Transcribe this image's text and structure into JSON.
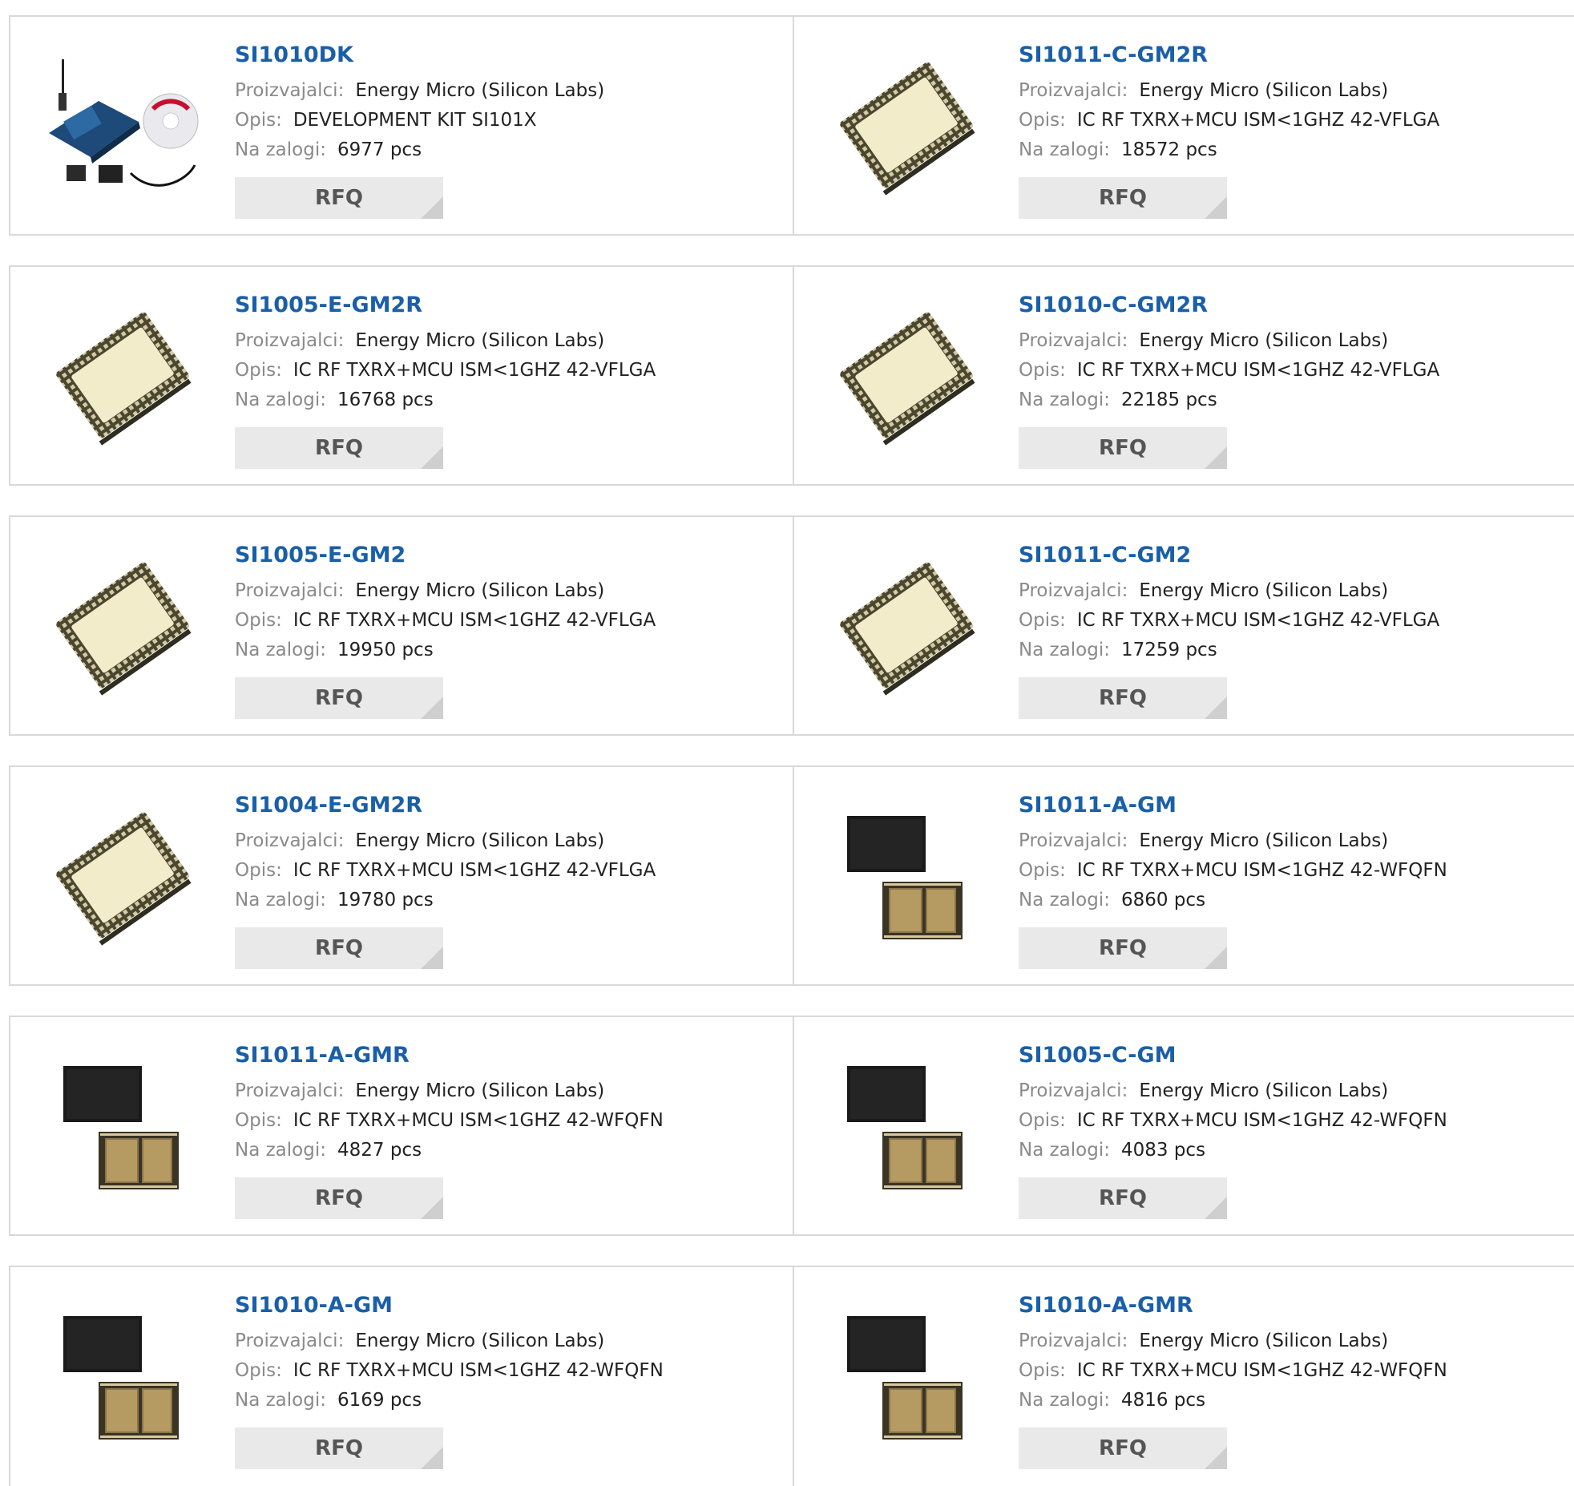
{
  "labels": {
    "manufacturer": "Proizvajalci:",
    "description": "Opis:",
    "stock": "Na zalogi:",
    "rfq": "RFQ"
  },
  "products": [
    {
      "name": "SI1010DK",
      "manufacturer": "Energy Micro (Silicon Labs)",
      "description": "DEVELOPMENT KIT SI101X",
      "stock": "6977 pcs",
      "image": "devkit"
    },
    {
      "name": "SI1011-C-GM2R",
      "manufacturer": "Energy Micro (Silicon Labs)",
      "description": "IC RF TXRX+MCU ISM<1GHZ 42-VFLGA",
      "stock": "18572 pcs",
      "image": "vflga"
    },
    {
      "name": "SI1005-E-GM2R",
      "manufacturer": "Energy Micro (Silicon Labs)",
      "description": "IC RF TXRX+MCU ISM<1GHZ 42-VFLGA",
      "stock": "16768 pcs",
      "image": "vflga"
    },
    {
      "name": "SI1010-C-GM2R",
      "manufacturer": "Energy Micro (Silicon Labs)",
      "description": "IC RF TXRX+MCU ISM<1GHZ 42-VFLGA",
      "stock": "22185 pcs",
      "image": "vflga"
    },
    {
      "name": "SI1005-E-GM2",
      "manufacturer": "Energy Micro (Silicon Labs)",
      "description": "IC RF TXRX+MCU ISM<1GHZ 42-VFLGA",
      "stock": "19950 pcs",
      "image": "vflga"
    },
    {
      "name": "SI1011-C-GM2",
      "manufacturer": "Energy Micro (Silicon Labs)",
      "description": "IC RF TXRX+MCU ISM<1GHZ 42-VFLGA",
      "stock": "17259 pcs",
      "image": "vflga"
    },
    {
      "name": "SI1004-E-GM2R",
      "manufacturer": "Energy Micro (Silicon Labs)",
      "description": "IC RF TXRX+MCU ISM<1GHZ 42-VFLGA",
      "stock": "19780 pcs",
      "image": "vflga"
    },
    {
      "name": "SI1011-A-GM",
      "manufacturer": "Energy Micro (Silicon Labs)",
      "description": "IC RF TXRX+MCU ISM<1GHZ 42-WFQFN",
      "stock": "6860 pcs",
      "image": "wfqfn"
    },
    {
      "name": "SI1011-A-GMR",
      "manufacturer": "Energy Micro (Silicon Labs)",
      "description": "IC RF TXRX+MCU ISM<1GHZ 42-WFQFN",
      "stock": "4827 pcs",
      "image": "wfqfn"
    },
    {
      "name": "SI1005-C-GM",
      "manufacturer": "Energy Micro (Silicon Labs)",
      "description": "IC RF TXRX+MCU ISM<1GHZ 42-WFQFN",
      "stock": "4083 pcs",
      "image": "wfqfn"
    },
    {
      "name": "SI1010-A-GM",
      "manufacturer": "Energy Micro (Silicon Labs)",
      "description": "IC RF TXRX+MCU ISM<1GHZ 42-WFQFN",
      "stock": "6169 pcs",
      "image": "wfqfn"
    },
    {
      "name": "SI1010-A-GMR",
      "manufacturer": "Energy Micro (Silicon Labs)",
      "description": "IC RF TXRX+MCU ISM<1GHZ 42-WFQFN",
      "stock": "4816 pcs",
      "image": "wfqfn"
    }
  ]
}
